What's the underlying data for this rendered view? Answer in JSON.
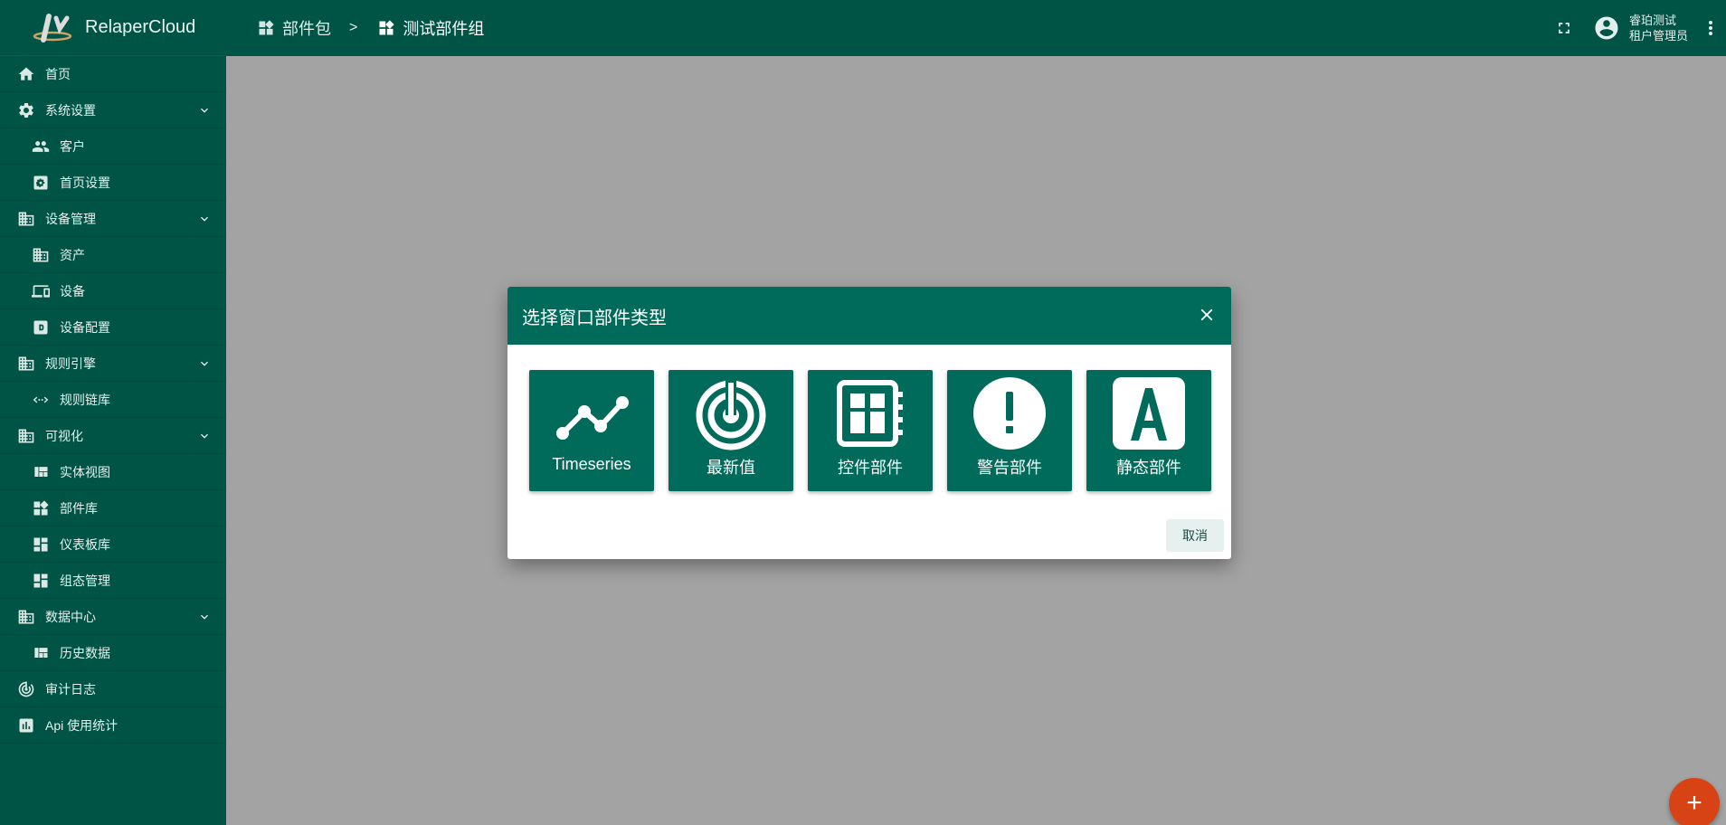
{
  "app": {
    "name": "RelaperCloud"
  },
  "sidebar": {
    "items": [
      {
        "label": "首页",
        "icon": "home-icon",
        "level": "top"
      },
      {
        "label": "系统设置",
        "icon": "gear-icon",
        "level": "top",
        "expanded": true
      },
      {
        "label": "客户",
        "icon": "people-icon",
        "level": "sub"
      },
      {
        "label": "首页设置",
        "icon": "settings-box-icon",
        "level": "sub"
      },
      {
        "label": "设备管理",
        "icon": "building-icon",
        "level": "top",
        "expanded": true
      },
      {
        "label": "资产",
        "icon": "building-icon",
        "level": "sub"
      },
      {
        "label": "设备",
        "icon": "devices-icon",
        "level": "sub"
      },
      {
        "label": "设备配置",
        "icon": "device-profile-icon",
        "level": "sub"
      },
      {
        "label": "规则引擎",
        "icon": "building-icon",
        "level": "top",
        "expanded": true
      },
      {
        "label": "规则链库",
        "icon": "code-arrows-icon",
        "level": "sub"
      },
      {
        "label": "可视化",
        "icon": "building-icon",
        "level": "top",
        "expanded": true
      },
      {
        "label": "实体视图",
        "icon": "view-quilt-icon",
        "level": "sub"
      },
      {
        "label": "部件库",
        "icon": "widgets-icon",
        "level": "sub"
      },
      {
        "label": "仪表板库",
        "icon": "dashboard-icon",
        "level": "sub"
      },
      {
        "label": "组态管理",
        "icon": "dashboard-icon",
        "level": "sub"
      },
      {
        "label": "数据中心",
        "icon": "building-icon",
        "level": "top",
        "expanded": true
      },
      {
        "label": "历史数据",
        "icon": "view-quilt-icon",
        "level": "sub"
      },
      {
        "label": "审计日志",
        "icon": "track-changes-icon",
        "level": "top"
      },
      {
        "label": "Api 使用统计",
        "icon": "bar-chart-icon",
        "level": "top"
      }
    ]
  },
  "header": {
    "breadcrumb": [
      {
        "label": "部件包",
        "icon": "widgets-icon"
      },
      {
        "label": "测试部件组",
        "icon": "widgets-icon"
      }
    ],
    "separator": ">",
    "user": {
      "name": "睿珀测试",
      "role": "租户管理员"
    }
  },
  "dialog": {
    "title": "选择窗口部件类型",
    "tiles": [
      {
        "label": "Timeseries",
        "icon": "timeseries-icon"
      },
      {
        "label": "最新值",
        "icon": "latest-value-icon"
      },
      {
        "label": "控件部件",
        "icon": "rpc-widget-icon"
      },
      {
        "label": "警告部件",
        "icon": "alarm-icon"
      },
      {
        "label": "静态部件",
        "icon": "static-icon"
      }
    ],
    "cancel_label": "取消"
  },
  "fab": {
    "label": "+"
  },
  "colors": {
    "primary": "#005446",
    "dialog_header": "#006b5a",
    "backdrop": "#a3a3a3",
    "fab": "#d84315"
  }
}
